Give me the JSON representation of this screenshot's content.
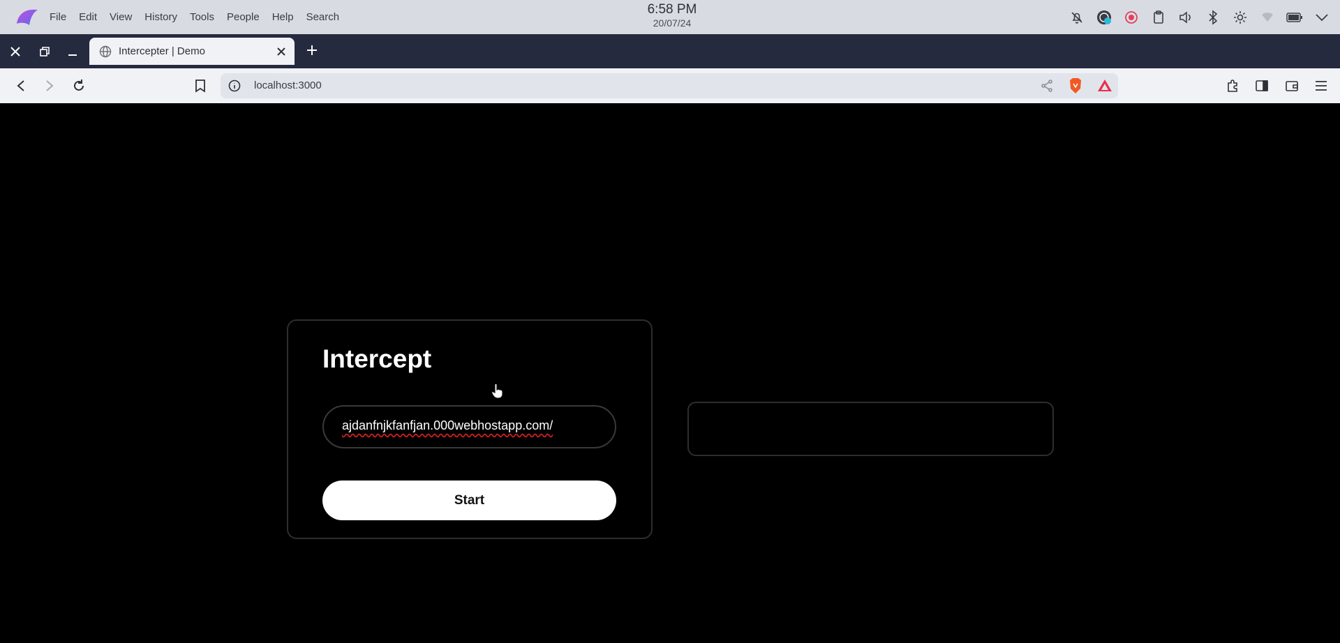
{
  "os": {
    "menu": [
      "File",
      "Edit",
      "View",
      "History",
      "Tools",
      "People",
      "Help",
      "Search"
    ],
    "clock_time": "6:58 PM",
    "clock_date": "20/07/24",
    "tray_icons": [
      "notifications-off-icon",
      "vpn-globe-icon",
      "record-icon",
      "clipboard-icon",
      "volume-icon",
      "bluetooth-icon",
      "brightness-icon",
      "wifi-icon",
      "battery-icon",
      "chevron-down-icon"
    ]
  },
  "browser": {
    "tab_title": "Intercepter | Demo",
    "url": "localhost:3000"
  },
  "app": {
    "heading": "Intercept",
    "input_value": "ajdanfnjkfanfjan.000webhostapp.com/",
    "start_label": "Start",
    "output_text": ""
  },
  "colors": {
    "os_bar": "#d9dbe2",
    "tab_strip": "#262a3e",
    "toolbar": "#f1f2f6",
    "page_bg": "#000000",
    "button_bg": "#ffffff",
    "spellcheck_underline": "#d02020",
    "brave_orange": "#f05a22"
  }
}
